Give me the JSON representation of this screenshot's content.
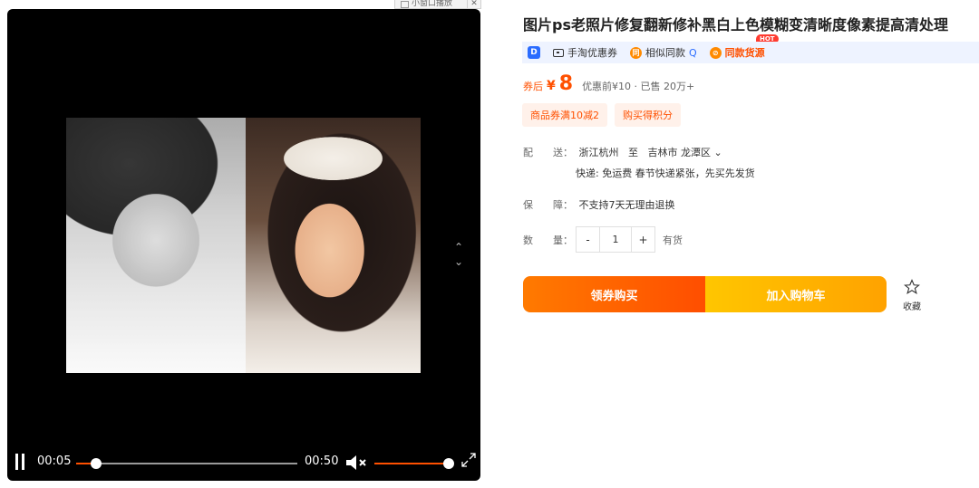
{
  "mini_window": {
    "label": "小窗口播放",
    "close": "✕"
  },
  "player": {
    "current_time": "00:05",
    "duration": "00:50",
    "progress_fraction": 0.09,
    "volume_fraction": 1.0,
    "side_up": "⌃",
    "side_down": "⌄"
  },
  "product": {
    "title": "图片ps老照片修复翻新修补黑白上色模糊变清晰度像素提高清处理",
    "tags": {
      "logo": "D",
      "coupon": "手淘优惠券",
      "similar_icon": "同",
      "similar": "相似同款",
      "similar_search": "Q",
      "source_icon": "⊘",
      "source": "同款货源",
      "hot": "HOT"
    },
    "price": {
      "label": "券后",
      "yen": "¥",
      "value": "8",
      "extra": "优惠前¥10 · 已售 20万+"
    },
    "promos": [
      "商品券满10减2",
      "购买得积分"
    ],
    "shipping": {
      "label": "配　　送：",
      "from": "浙江杭州",
      "to_word": "至",
      "to": "吉林市 龙潭区",
      "to_arrow": "⌄",
      "detail": "快递: 免运费  春节快递紧张，先买先发货"
    },
    "guarantee": {
      "label": "保　　障：",
      "value": "不支持7天无理由退换"
    },
    "quantity": {
      "label": "数　　量：",
      "minus": "-",
      "value": "1",
      "plus": "+",
      "stock": "有货"
    },
    "buttons": {
      "buy": "领券购买",
      "cart": "加入购物车",
      "favorite": "收藏"
    }
  },
  "colors": {
    "accent": "#ff5000",
    "cart": "#ffb400",
    "tagbar": "#eef3ff"
  }
}
